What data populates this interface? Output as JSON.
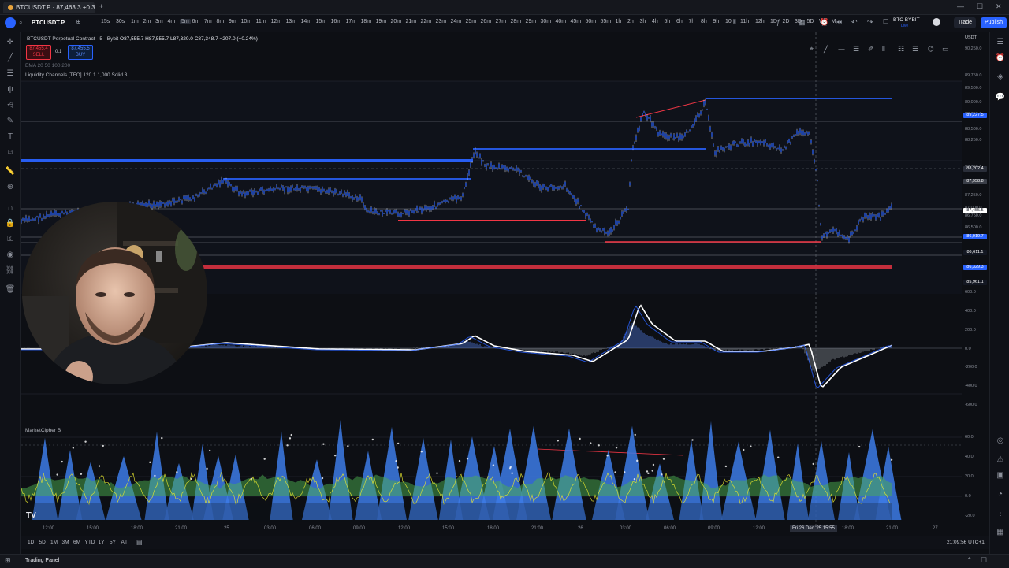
{
  "browser": {
    "tab_title": "BTCUSDT.P · 87,463.3 +0.33%",
    "badge": "18"
  },
  "toolbar": {
    "symbol": "BTCUSDT.P",
    "timeframes": [
      "15s",
      "30s",
      "1m",
      "2m",
      "3m",
      "4m",
      "5m",
      "6m",
      "7m",
      "8m",
      "9m",
      "10m",
      "11m",
      "12m",
      "13m",
      "14m",
      "15m",
      "16m",
      "17m",
      "18m",
      "19m",
      "20m",
      "21m",
      "22m",
      "23m",
      "24m",
      "25m",
      "26m",
      "27m",
      "28m",
      "29m",
      "30m",
      "40m",
      "45m",
      "50m",
      "55m",
      "1h",
      "2h",
      "3h",
      "4h",
      "5h",
      "6h",
      "7h",
      "8h",
      "9h",
      "10h",
      "11h",
      "12h",
      "1D",
      "2D",
      "3D",
      "5D",
      "W",
      "M"
    ],
    "active_timeframe": "5m",
    "broker_label": "BTC BYBIT",
    "broker_sub": "Live",
    "trade_label": "Trade",
    "publish_label": "Publish"
  },
  "legend": {
    "title": "BTCUSDT Perpetual Contract · 5 · Bybit",
    "ohlc": "O87,555.7 H87,555.7 L87,320.0 C87,348.7 −207.0 (−0.24%)",
    "sell_price": "87,455.4",
    "sell_label": "SELL",
    "spread": "0.1",
    "buy_price": "87,455.5",
    "buy_label": "BUY",
    "ema_label": "EMA 20 50 100 200",
    "indicator": "Liquidity Channels [TFO] 120 1 1,000 Solid 3",
    "market_cipher": "MarketCipher B"
  },
  "price_axis": {
    "currency": "USDT",
    "main_labels": [
      "90,250.0",
      "89,750.0",
      "89,500.0",
      "89,000.0",
      "88,750.0",
      "88,500.0",
      "88,250.0",
      "87,750.0",
      "87,250.0",
      "87,000.0",
      "86,750.0",
      "86,500.0"
    ],
    "badges": [
      {
        "text": "89,227.5",
        "color": "#2962ff"
      },
      {
        "text": "88,202.4",
        "color": "#2a2e39"
      },
      {
        "text": "87,958.8",
        "color": "#3a3e48"
      },
      {
        "text": "87,455.5",
        "color": "#ffffff"
      },
      {
        "text": "86,919.7",
        "color": "#2962ff"
      },
      {
        "text": "86,611.1",
        "color": "#131722"
      },
      {
        "text": "86,329.3",
        "color": "#2962ff"
      },
      {
        "text": "85,961.1",
        "color": "#131722"
      }
    ],
    "osc_labels": [
      "600.0",
      "400.0",
      "200.0",
      "0.0",
      "-200.0",
      "-400.0",
      "-600.0"
    ],
    "mc_labels": [
      "60.0",
      "40.0",
      "20.0",
      "0.0",
      "-20.0"
    ]
  },
  "time_axis": {
    "labels": [
      "12:00",
      "15:00",
      "18:00",
      "21:00",
      "25",
      "03:00",
      "06:00",
      "09:00",
      "12:00",
      "15:00",
      "18:00",
      "21:00",
      "26",
      "03:00",
      "06:00",
      "09:00",
      "12:00",
      "18:00",
      "21:00",
      "27"
    ],
    "crosshair_label": "Fri 26 Dec '25  15:55"
  },
  "bottom": {
    "ranges": [
      "1D",
      "5D",
      "1M",
      "3M",
      "6M",
      "YTD",
      "1Y",
      "5Y",
      "All"
    ],
    "clock": "21:09:56 UTC+1",
    "trading_panel": "Trading Panel"
  },
  "colors": {
    "candle": "#2962ff",
    "resistance": "#2962ff",
    "support": "#f23645",
    "osc_line": "#ffffff",
    "mc_wave": "#3d7be6",
    "mc_money": "#4caf50",
    "mc_yellow": "#e6e62e"
  },
  "icons": {
    "left_tools": [
      "crosshair-icon",
      "trendline-icon",
      "fib-icon",
      "pitchfork-icon",
      "brush-icon",
      "text-icon",
      "smile-icon",
      "ruler-icon",
      "zoom-icon",
      "magnet-icon",
      "lock-icon",
      "eye-icon",
      "link-icon",
      "trash-icon"
    ],
    "right_tools": [
      "watchlist-icon",
      "alerts-icon",
      "object-tree-icon",
      "chat-icon"
    ]
  }
}
